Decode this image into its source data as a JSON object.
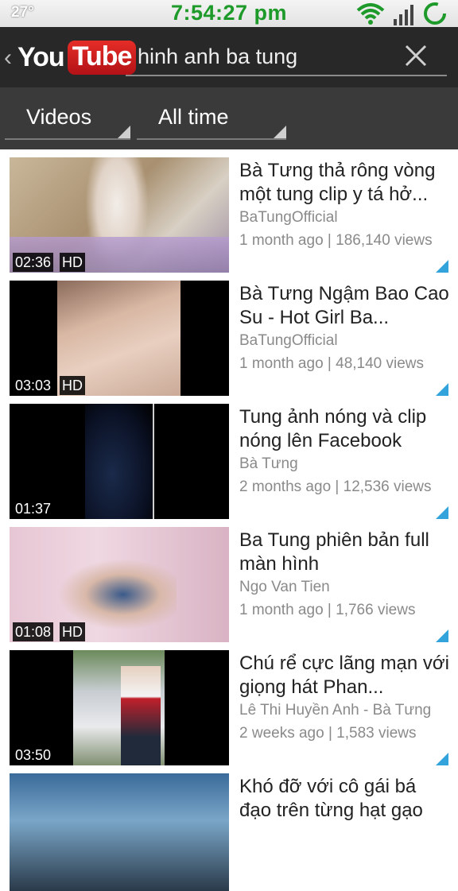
{
  "status_bar": {
    "temperature": "27°",
    "time": "7:54:27 pm",
    "icons": [
      "wifi-icon",
      "cell-signal-icon",
      "loading-ring-icon"
    ]
  },
  "action_bar": {
    "logo_you": "You",
    "logo_tube": "Tube",
    "search_value": "hinh anh ba tung"
  },
  "filters": {
    "type": "Videos",
    "time": "All time"
  },
  "videos": [
    {
      "title": "Bà Tưng thả rông vòng một tung clip y tá hở...",
      "channel": "BaTungOfficial",
      "meta": "1 month ago | 186,140 views",
      "duration": "02:36",
      "hd": "HD"
    },
    {
      "title": "Bà Tưng Ngậm Bao Cao Su - Hot Girl Ba...",
      "channel": "BaTungOfficial",
      "meta": "1 month ago | 48,140 views",
      "duration": "03:03",
      "hd": "HD"
    },
    {
      "title": "Tung ảnh nóng và clip nóng lên Facebook",
      "channel": "Bà Tưng",
      "meta": "2 months ago | 12,536 views",
      "duration": "01:37",
      "hd": ""
    },
    {
      "title": "Ba Tung phiên bản full màn hình",
      "channel": "Ngo Van Tien",
      "meta": "1 month ago | 1,766 views",
      "duration": "01:08",
      "hd": "HD"
    },
    {
      "title": "Chú rể cực lãng mạn với giọng hát Phan...",
      "channel": "Lê Thi Huyền Anh - Bà Tưng",
      "meta": "2 weeks ago | 1,583 views",
      "duration": "03:50",
      "hd": ""
    },
    {
      "title": "Khó đỡ với cô gái bá đạo trên từng hạt gạo",
      "channel": "",
      "meta": "",
      "duration": "",
      "hd": ""
    }
  ],
  "colors": {
    "status_time": "#1e9a2a",
    "action_bar": "#282828",
    "filter_bar": "#3a3a3a",
    "accent_corner": "#33a3dc",
    "logo_red": "#e52d27"
  }
}
